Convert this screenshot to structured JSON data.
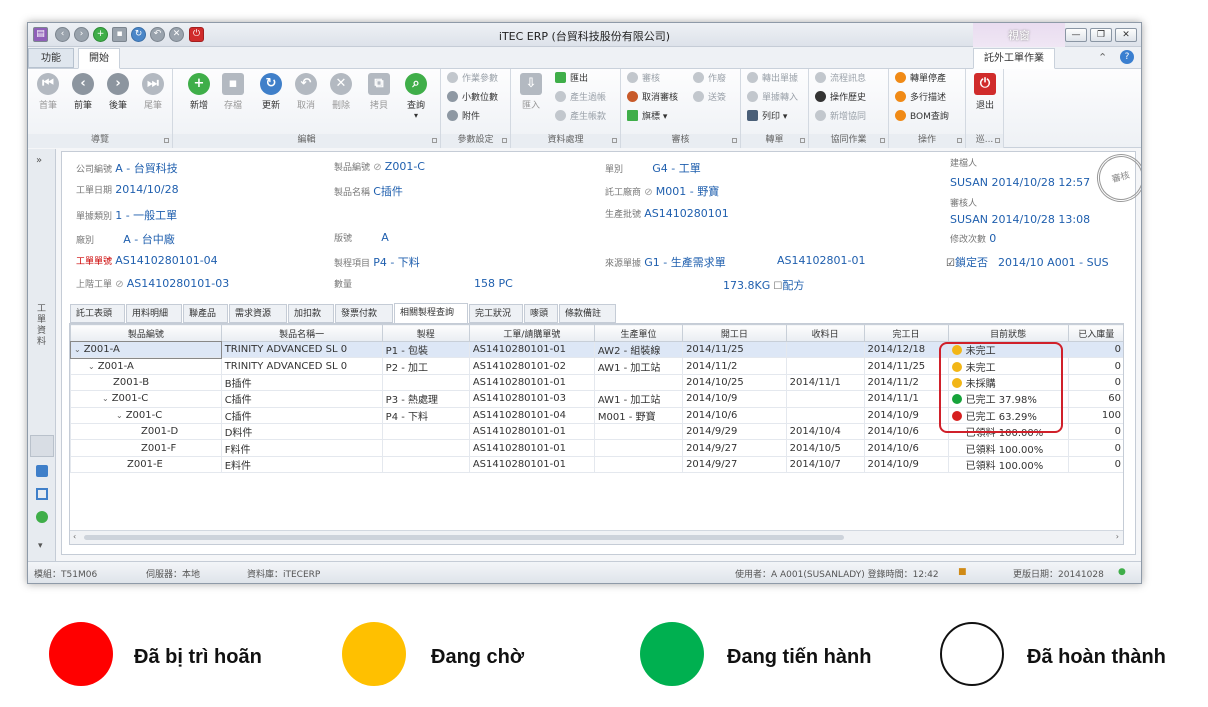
{
  "window": {
    "title": "iTEC ERP (台貿科技股份有限公司)",
    "context_header": "視窗",
    "context_tab": "託外工單作業"
  },
  "ribbon_tabs": [
    "功能",
    "開始"
  ],
  "ribbon": {
    "groups": [
      "導覽",
      "編輯",
      "參數設定",
      "資料處理",
      "審核",
      "轉單",
      "協同作業",
      "操作",
      "巡..."
    ],
    "nav_buttons": [
      "首筆",
      "前筆",
      "後筆",
      "尾筆"
    ],
    "edit_buttons": [
      "新增",
      "存檔",
      "更新",
      "取消",
      "刪除",
      "拷貝",
      "查詢"
    ],
    "param_items": [
      "作業參數",
      "小數位數",
      "附件"
    ],
    "data_import": "匯入",
    "data_items": [
      "匯出",
      "產生過帳",
      "產生帳款"
    ],
    "audit_items": [
      "審核",
      "取消審核",
      "旗標",
      "作廢",
      "送簽"
    ],
    "transfer_items": [
      "轉出單據",
      "單據轉入",
      "列印"
    ],
    "collab_items": [
      "流程訊息",
      "操作歷史",
      "新增協同"
    ],
    "op_items": [
      "轉單停產",
      "多行描述",
      "BOM查詢"
    ],
    "exit": "退出"
  },
  "left_panel_label": "工單資料",
  "header": {
    "company_k": "公司編號",
    "company_v": "A - 台貿科技",
    "date_k": "工單日期",
    "date_v": "2014/10/28",
    "doctype_k": "單據類別",
    "doctype_v": "1 - 一般工單",
    "factory_k": "廠別",
    "factory_v": "A - 台中廠",
    "wo_k": "工單單號",
    "wo_v": "AS1410280101-04",
    "upper_k": "上階工單",
    "upper_v": "AS1410280101-03",
    "part_k": "製品編號",
    "part_v": "Z001-C",
    "pname_k": "製品名稱",
    "pname_v": "C插件",
    "ver_k": "版號",
    "ver_v": "A",
    "proc_k": "製程項目",
    "proc_v": "P4 - 下料",
    "qty_k": "數量",
    "qty_v": "158 PC",
    "weight_v": "173.8KG",
    "recipe_label": "配方",
    "type_k": "單別",
    "type_v": "G4 - 工單",
    "vendor_k": "託工廠商",
    "vendor_v": "M001 - 野寶",
    "batch_k": "生產批號",
    "batch_v": "AS1410280101",
    "source_k": "來源單據",
    "source_v": "G1 - 生產需求單",
    "source_no": "AS14102801-01",
    "creator_k": "建檔人",
    "creator_v": "SUSAN 2014/10/28 12:57",
    "auditor_k": "審核人",
    "auditor_v": "SUSAN 2014/10/28 13:08",
    "modcount_k": "修改次數",
    "modcount_v": "0",
    "lock_k": "鎖定否",
    "lock_v": "2014/10  A001 - SUS",
    "stamp": "審核"
  },
  "subtabs": [
    "託工表頭",
    "用料明細",
    "聯產品",
    "需求資源",
    "加扣款",
    "發票付款",
    "相關製程查詢",
    "完工狀況",
    "嘜頭",
    "條款備註"
  ],
  "active_subtab": 6,
  "grid": {
    "columns": [
      "製品編號",
      "製品名稱一",
      "製程",
      "工單/請購單號",
      "生產單位",
      "開工日",
      "收料日",
      "完工日",
      "目前狀態",
      "已入庫量"
    ],
    "rows": [
      {
        "level": 0,
        "toggle": "⌄",
        "part": "Z001-A",
        "name": "TRINITY ADVANCED SL 0",
        "process": "P1 - 包裝",
        "order": "AS1410280101-01",
        "unit": "AW2 - 組裝線",
        "start": "2014/11/25",
        "recv": "",
        "finish": "2014/12/18",
        "status": "未完工",
        "status_color": "#f2b616",
        "qty": "0"
      },
      {
        "level": 1,
        "toggle": "⌄",
        "part": "Z001-A",
        "name": "TRINITY ADVANCED SL 0",
        "process": "P2 - 加工",
        "order": "AS1410280101-02",
        "unit": "AW1 - 加工站",
        "start": "2014/11/2",
        "recv": "",
        "finish": "2014/11/25",
        "status": "未完工",
        "status_color": "#f2b616",
        "qty": "0"
      },
      {
        "level": 2,
        "toggle": "",
        "part": "Z001-B",
        "name": "B插件",
        "process": "",
        "order": "AS1410280101-01",
        "unit": "",
        "start": "2014/10/25",
        "recv": "2014/11/1",
        "finish": "2014/11/2",
        "status": "未採購",
        "status_color": "#f2b616",
        "qty": "0"
      },
      {
        "level": 2,
        "toggle": "⌄",
        "part": "Z001-C",
        "name": "C插件",
        "process": "P3 - 熱處理",
        "order": "AS1410280101-03",
        "unit": "AW1 - 加工站",
        "start": "2014/10/9",
        "recv": "",
        "finish": "2014/11/1",
        "status": "已完工 37.98%",
        "status_color": "#16a33a",
        "qty": "60"
      },
      {
        "level": 3,
        "toggle": "⌄",
        "part": "Z001-C",
        "name": "C插件",
        "process": "P4 - 下料",
        "order": "AS1410280101-04",
        "unit": "M001 - 野寶",
        "start": "2014/10/6",
        "recv": "",
        "finish": "2014/10/9",
        "status": "已完工 63.29%",
        "status_color": "#d61f1f",
        "qty": "100"
      },
      {
        "level": 4,
        "toggle": "",
        "part": "Z001-D",
        "name": "D料件",
        "process": "",
        "order": "AS1410280101-01",
        "unit": "",
        "start": "2014/9/29",
        "recv": "2014/10/4",
        "finish": "2014/10/6",
        "status": "已領料 100.00%",
        "status_color": "",
        "qty": "0"
      },
      {
        "level": 4,
        "toggle": "",
        "part": "Z001-F",
        "name": "F料件",
        "process": "",
        "order": "AS1410280101-01",
        "unit": "",
        "start": "2014/9/27",
        "recv": "2014/10/5",
        "finish": "2014/10/6",
        "status": "已領料 100.00%",
        "status_color": "",
        "qty": "0"
      },
      {
        "level": 3,
        "toggle": "",
        "part": "Z001-E",
        "name": "E料件",
        "process": "",
        "order": "AS1410280101-01",
        "unit": "",
        "start": "2014/9/27",
        "recv": "2014/10/7",
        "finish": "2014/10/9",
        "status": "已領料 100.00%",
        "status_color": "",
        "qty": "0"
      }
    ]
  },
  "statusbar": {
    "module": "模組：T51M06",
    "server": "伺服器：本地",
    "db": "資料庫：iTECERP",
    "user": "使用者：A A001(SUSANLADY)  登錄時間：12:42",
    "updated": "更版日期：20141028"
  },
  "legend": [
    {
      "label": "Đã bị trì hoãn",
      "color": "#ff0000"
    },
    {
      "label": "Đang chờ",
      "color": "#ffc000"
    },
    {
      "label": "Đang tiến hành",
      "color": "#00b050"
    },
    {
      "label": "Đã hoàn thành",
      "color": "#ffffff"
    }
  ]
}
